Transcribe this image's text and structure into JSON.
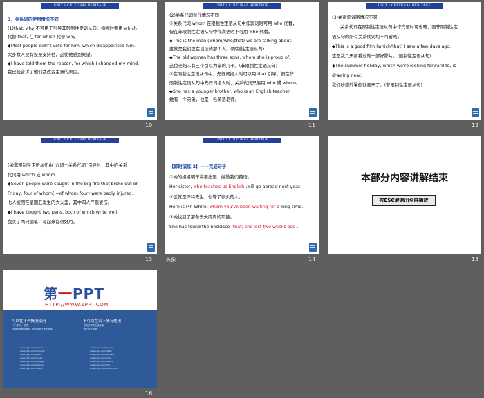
{
  "header_label": "UNIT 1   CULTURAL HERITAGE",
  "slide_numbers": [
    "10",
    "11",
    "12",
    "13",
    "14",
    "15",
    "16"
  ],
  "s10": {
    "title": "3．关系词的使用情况不同",
    "l1": "(1)that, why 不可用于引导非限制性定语从句。指物时要用 which",
    "l2": "代替 that, 在 for which 代替 why",
    "l3": "◆Most people didn’t vote for him, which disappointed him.",
    "l4": "大多数人没有投票支持他，这使他感到失望。",
    "l5": "◆I have told them the reason, for which I changed my mind.",
    "l6": "我已经告诉了他们我改变主意的原因。"
  },
  "s11": {
    "l1": "(2)关系代词替代情况不同",
    "l2": "①关系代词 whom 在限制性定语从句中作宾语时可用 who 代替，",
    "l3": "但在非限制性定语从句中作宾语时不可用 who 代替。",
    "l4": "◆This is the man (whom/who/that) we are talking about.",
    "l5": "这就是我们正在谈论的那个人。(限制性定语从句)",
    "l6": "◆The old woman has three sons, whom she is proud of.",
    "l7": "这位老妇人有三个引以为豪的儿子。(非限制性定语从句)",
    "l8": "②在限制性定语从句中，先行词指人时可以用 that 引导，但在非",
    "l9": "限制性定语从句中先行词指人时，关系代词只能用 who 或 whom。",
    "l10": "◆She has a younger brother, who is an English teacher.",
    "l11": "她有一个弟弟，他是一名英语老师。"
  },
  "s12": {
    "l1": "(3)关系词省略情况不同",
    "l2": "关系代词在限制性定语从句中作宾语时可省略，而非限制性定",
    "l3": "语从句的所有关系代词均不可省略。",
    "l4": "◆This is a good film (which/that) I saw a few days ago.",
    "l5": "这是我几天前看过的一部好影片。(限制性定语从句)",
    "l6": "◆The summer holiday, which we’re looking forward to, is",
    "l7": "drawing near.",
    "l8": "我们盼望的暑假就要来了。(非限制性定语从句)"
  },
  "s13": {
    "l1": "(4)非限制性定语从句由“介词＋关系代词”引导时，其中的关系",
    "l2": "代词用 which 或 whom",
    "l3": "◆Seven people were caught in the big fire that broke out on",
    "l4": "Friday, four of whom( =of whom four) were badly injured.",
    "l5": "七人被困在星期五发生的大火里，其中四人严重受伤。",
    "l6": "◆I have bought two pens, both of which write well.",
    "l7": "我买了两只钢笔，写起来都很好用。"
  },
  "s14": {
    "title": "【即时演练 2】——完成句子",
    "l1": "①她的姐姐明年将要出国，她教我们英语。",
    "l2a": "Her sister,",
    "a1": "who teaches us English",
    "l2b": ",will go abroad next year.",
    "l3": "②这就是怀特先生，你等了很久的人。",
    "l4a": "Here is Mr. White,",
    "a2": "whom you’ve been waiting for",
    "l4b": "a long time.",
    "l5": "③她找到了那条丢失两周的项链。",
    "l6a": "She has found the necklace",
    "a3": "(that) she lost two weeks ago",
    "l6b": ".",
    "footer_icon": "头像"
  },
  "s15": {
    "title": "本部分内容讲解结束",
    "button": "按ESC键退出全屏播放"
  },
  "s16": {
    "logo_a": "第",
    "logo_b": "一",
    "logo_c": "PPT",
    "url": "HTTP://WWW.1PPT.COM",
    "col1_title": "可以在下列情况使用",
    "col1_l1": "·个人学习、研究。",
    "col1_l2": "·非商业用途的演示，但请勿用于商业用途。",
    "col2_title": "不可以在以下情况使用",
    "col2_l1": "·任何形式的在线传播。",
    "col2_l2": "·用于商业用途。",
    "links_a": "www.1ppt.com/moban/\nwww.1ppt.com/hangye/\nwww.1ppt.com/jieri/\nwww.1ppt.com/sucai/\nwww.1ppt.com/beijing/\nwww.1ppt.com/tubiao/\nwww.1ppt.com/xiazai/",
    "links_b": "www.1ppt.com/kejian/\nwww.1ppt.com/ziliao/\nwww.1ppt.com/fanwen/\nwww.1ppt.com/shiti/\nwww.1ppt.com/jiaoan/\nwww.1ppt.com/ziti/\nwww.1ppt.com/powerpoint/"
  }
}
